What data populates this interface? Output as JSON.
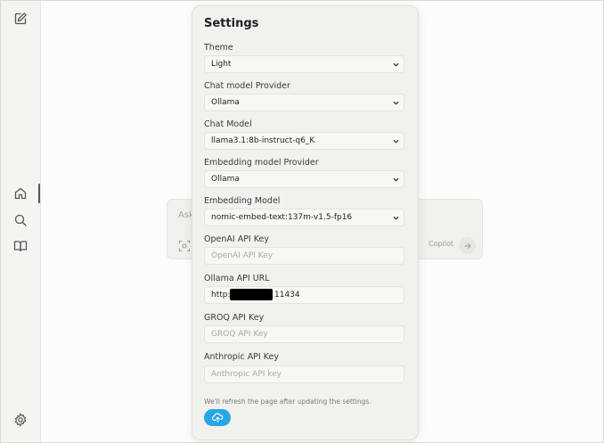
{
  "sidebar": {
    "icons": [
      "new-chat-icon",
      "home-icon",
      "search-icon",
      "library-icon",
      "settings-icon"
    ]
  },
  "ask_box": {
    "placeholder_partial": "Ask",
    "copilot_label": "Copilot"
  },
  "settings": {
    "title": "Settings",
    "theme": {
      "label": "Theme",
      "value": "Light"
    },
    "chat_provider": {
      "label": "Chat model Provider",
      "value": "Ollama"
    },
    "chat_model": {
      "label": "Chat Model",
      "value": "llama3.1:8b-instruct-q6_K"
    },
    "embedding_provider": {
      "label": "Embedding model Provider",
      "value": "Ollama"
    },
    "embedding_model": {
      "label": "Embedding Model",
      "value": "nomic-embed-text:137m-v1.5-fp16"
    },
    "openai_key": {
      "label": "OpenAI API Key",
      "placeholder": "OpenAI API Key",
      "value": ""
    },
    "ollama_url": {
      "label": "Ollama API URL",
      "value_prefix": "http://",
      "value_suffix": "11434"
    },
    "groq_key": {
      "label": "GROQ API Key",
      "placeholder": "GROQ API Key",
      "value": ""
    },
    "anthropic_key": {
      "label": "Anthropic API Key",
      "placeholder": "Anthropic API key",
      "value": ""
    },
    "note": "We'll refresh the page after updating the settings.",
    "save_icon": "cloud-upload-icon"
  },
  "colors": {
    "accent": "#27a6e8",
    "dialog_bg": "#f1f1ed",
    "page_bg": "#fcfcfa"
  }
}
